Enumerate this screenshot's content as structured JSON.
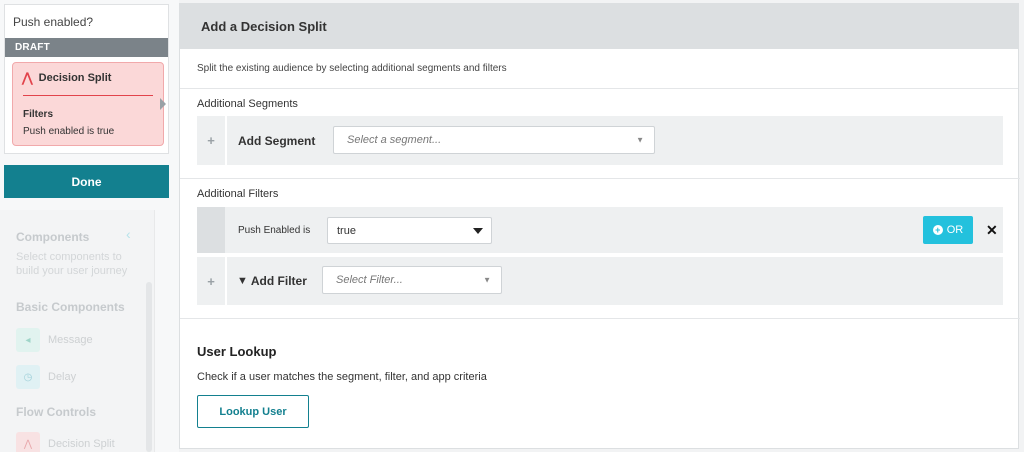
{
  "background": {
    "components_title": "Components",
    "components_subtitle": "Select components to build your user journey",
    "basic_components": "Basic Components",
    "items": [
      {
        "label": "Message",
        "icon": "message-icon"
      },
      {
        "label": "Delay",
        "icon": "clock-icon"
      }
    ],
    "flow_controls": "Flow Controls",
    "flow_items": [
      {
        "label": "Decision Split",
        "icon": "split-icon"
      }
    ]
  },
  "node": {
    "title": "Push enabled?",
    "status": "DRAFT",
    "card_title": "Decision Split",
    "filters_label": "Filters",
    "filter_summary": "Push enabled is true",
    "done_label": "Done"
  },
  "modal": {
    "title": "Add a Decision Split",
    "description": "Split the existing audience by selecting additional segments and filters",
    "segments": {
      "title": "Additional Segments",
      "add_label": "Add Segment",
      "placeholder": "Select a segment..."
    },
    "filters": {
      "title": "Additional Filters",
      "rows": [
        {
          "name": "Push Enabled is",
          "value": "true"
        }
      ],
      "or_label": "OR",
      "remove_symbol": "✕",
      "add_label": "Add Filter",
      "placeholder": "Select Filter..."
    },
    "lookup": {
      "title": "User Lookup",
      "description": "Check if a user matches the segment, filter, and app criteria",
      "button_label": "Lookup User"
    }
  },
  "colors": {
    "accent": "#13808f",
    "or_button": "#23c1dd",
    "split_red": "#e2434b",
    "split_card": "#fbd8d8"
  }
}
